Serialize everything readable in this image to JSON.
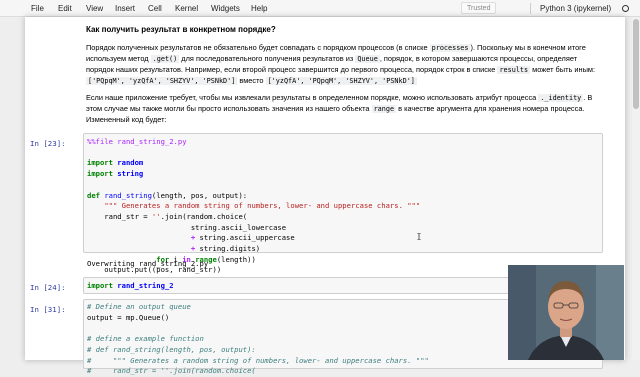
{
  "menubar": {
    "items": [
      "File",
      "Edit",
      "View",
      "Insert",
      "Cell",
      "Kernel",
      "Widgets",
      "Help"
    ],
    "trusted": "Trusted",
    "kernel": "Python 3 (ipykernel)"
  },
  "md1": {
    "heading": "Как получить результат в конкретном порядке?",
    "p1_l1_a": "Порядок полученных результатов не обязательно будет совпадать с порядком процессов (в списке ",
    "p1_l1_code": "processes",
    "p1_l1_b": "). Поскольку мы в конечном итоге",
    "p1_l2_a": "используем метод ",
    "p1_l2_code1": ".get()",
    "p1_l2_b": " для последовательного получения результатов из ",
    "p1_l2_code2": "Queue",
    "p1_l2_c": ", порядок, в котором завершаются процессы, определяет",
    "p1_l3_a": "порядок наших результатов. Например, если второй процесс завершится до первого процесса, порядок строк в списке ",
    "p1_l3_code": "results",
    "p1_l3_b": " может быть иным:",
    "p1_l4_code1": "['PQpqM', 'yzQfA', 'SHZYV', 'PSNkD']",
    "p1_l4_a": " вместо ",
    "p1_l4_code2": "['yzQfA', 'PQpqM', 'SHZYV', 'PSNkD']",
    "p2_l1_a": "Если наше приложение требует, чтобы мы извлекали результаты в определенном порядке, можно использовать атрибут процесса ",
    "p2_l1_code": "._identity",
    "p2_l1_b": ". В",
    "p2_l2_a": "этом случае мы также могли бы просто использовать значения из нашего объекта ",
    "p2_l2_code": "range",
    "p2_l2_b": " в качестве аргумента для хранения номера процесса.",
    "p2_l3": "Измененный код будет:"
  },
  "cell23": {
    "prompt": "In [23]:",
    "output": "Overwriting rand_string_2.py"
  },
  "cell24": {
    "prompt": "In [24]:"
  },
  "cell31": {
    "prompt": "In [31]:"
  }
}
